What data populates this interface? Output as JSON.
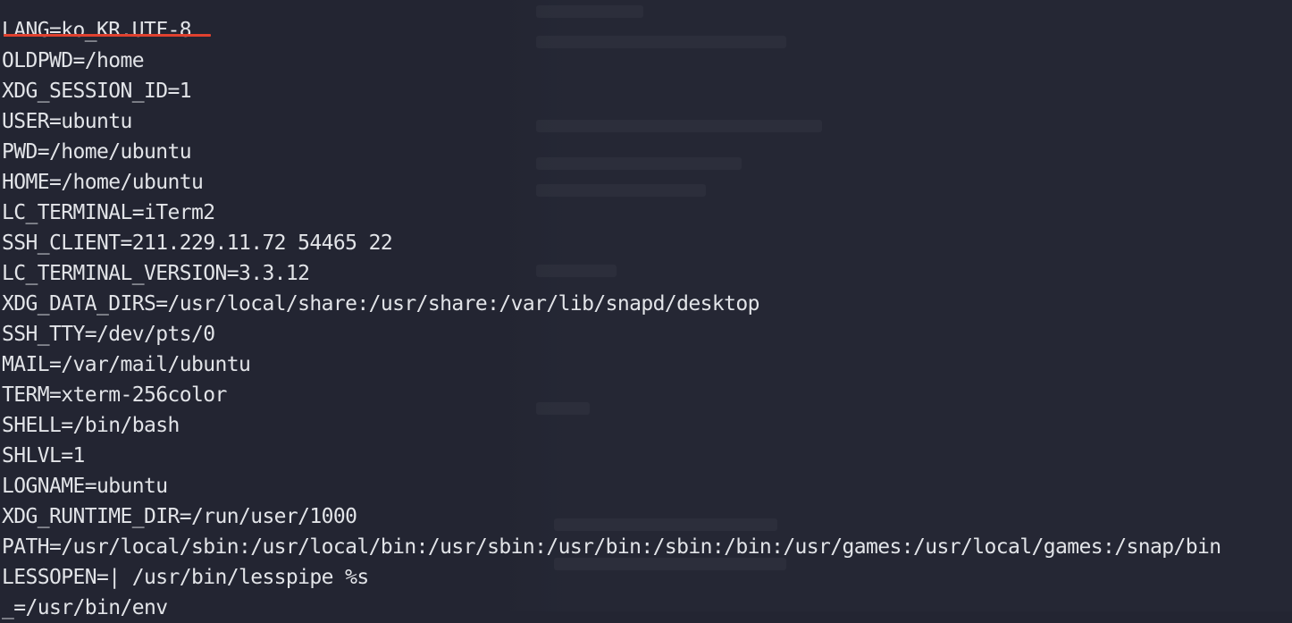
{
  "terminal": {
    "lines": [
      "",
      "LANG=ko_KR.UTF-8",
      "OLDPWD=/home",
      "XDG_SESSION_ID=1",
      "USER=ubuntu",
      "PWD=/home/ubuntu",
      "HOME=/home/ubuntu",
      "LC_TERMINAL=iTerm2",
      "SSH_CLIENT=211.229.11.72 54465 22",
      "LC_TERMINAL_VERSION=3.3.12",
      "XDG_DATA_DIRS=/usr/local/share:/usr/share:/var/lib/snapd/desktop",
      "SSH_TTY=/dev/pts/0",
      "MAIL=/var/mail/ubuntu",
      "TERM=xterm-256color",
      "SHELL=/bin/bash",
      "SHLVL=1",
      "LOGNAME=ubuntu",
      "XDG_RUNTIME_DIR=/run/user/1000",
      "PATH=/usr/local/sbin:/usr/local/bin:/usr/sbin:/usr/bin:/sbin:/bin:/usr/games:/usr/local/games:/snap/bin",
      "LESSOPEN=| /usr/bin/lesspipe %s",
      "_=/usr/bin/env"
    ],
    "highlighted_line_index": 1
  },
  "colors": {
    "background": "#232532",
    "text": "#e2e4e8",
    "highlight_underline": "#e0412f"
  }
}
